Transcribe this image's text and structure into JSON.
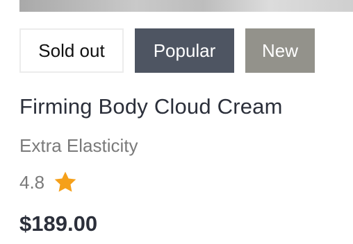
{
  "badges": {
    "sold_out": "Sold out",
    "popular": "Popular",
    "new": "New"
  },
  "product": {
    "title": "Firming Body Cloud Cream",
    "subtitle": "Extra Elasticity",
    "rating": "4.8",
    "price": "$189.00"
  },
  "icons": {
    "rating": "star-icon"
  },
  "colors": {
    "popular_badge": "#4e5562",
    "new_badge": "#93928b",
    "star": "#f5a01a",
    "text_dark": "#2b2f3a",
    "text_muted": "#7a7a7a"
  }
}
